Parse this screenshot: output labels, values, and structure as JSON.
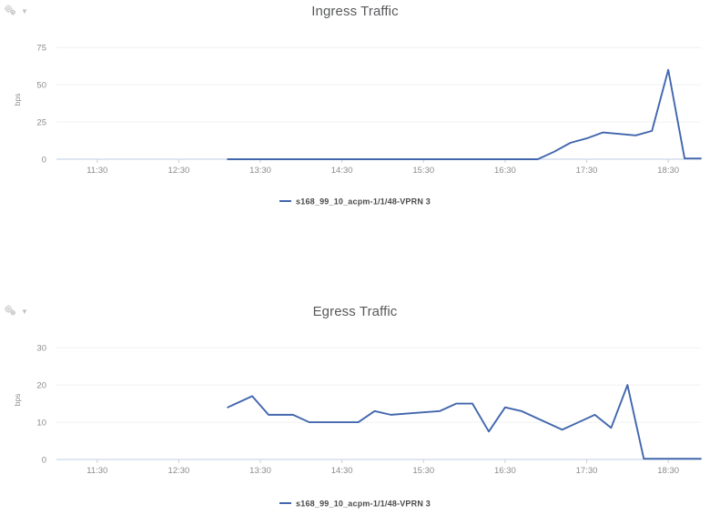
{
  "panels": [
    {
      "id": "ingress",
      "title": "Ingress Traffic",
      "gear_icon": "gear-icon",
      "caret_icon": "chevron-down-icon",
      "legend": {
        "label": "s168_99_10_acpm-1/1/48-VPRN 3",
        "color": "#4166ad"
      }
    },
    {
      "id": "egress",
      "title": "Egress Traffic",
      "gear_icon": "gear-icon",
      "caret_icon": "chevron-down-icon",
      "legend": {
        "label": "s168_99_10_acpm-1/1/48-VPRN 3",
        "color": "#4166ad"
      }
    }
  ],
  "chart_data": [
    {
      "type": "line",
      "title": "Ingress Traffic",
      "xlabel": "",
      "ylabel": "bps",
      "grid": true,
      "legend_position": "bottom",
      "xtick_labels": [
        "11:30",
        "12:30",
        "13:30",
        "14:30",
        "15:30",
        "16:30",
        "17:30",
        "18:30"
      ],
      "ytick_labels": [
        "0",
        "25",
        "50",
        "75"
      ],
      "ylim": [
        0,
        80
      ],
      "xlim": [
        "11:00",
        "18:54"
      ],
      "series": [
        {
          "name": "s168_99_10_acpm-1/1/48-VPRN 3",
          "color": "#4166ad",
          "x": [
            "13:06",
            "13:18",
            "13:30",
            "13:42",
            "13:54",
            "14:06",
            "14:18",
            "14:30",
            "14:42",
            "14:54",
            "15:06",
            "15:18",
            "15:30",
            "15:42",
            "15:54",
            "16:06",
            "16:18",
            "16:30",
            "16:42",
            "16:54",
            "17:06",
            "17:18",
            "17:30",
            "17:42",
            "17:54",
            "18:06",
            "18:18",
            "18:30",
            "18:42",
            "18:54"
          ],
          "values": [
            0,
            0,
            0,
            0,
            0,
            0,
            0,
            0,
            0,
            0,
            0,
            0,
            0,
            0,
            0,
            0,
            0,
            0,
            0,
            0,
            5,
            11,
            14,
            18,
            17,
            16,
            19,
            60,
            0.5,
            0.5
          ]
        }
      ]
    },
    {
      "type": "line",
      "title": "Egress Traffic",
      "xlabel": "",
      "ylabel": "bps",
      "grid": true,
      "legend_position": "bottom",
      "xtick_labels": [
        "11:30",
        "12:30",
        "13:30",
        "14:30",
        "15:30",
        "16:30",
        "17:30",
        "18:30"
      ],
      "ytick_labels": [
        "0",
        "10",
        "20",
        "30"
      ],
      "ylim": [
        0,
        32
      ],
      "xlim": [
        "11:00",
        "18:54"
      ],
      "series": [
        {
          "name": "s168_99_10_acpm-1/1/48-VPRN 3",
          "color": "#4166ad",
          "x": [
            "13:06",
            "13:24",
            "13:36",
            "13:54",
            "14:06",
            "14:24",
            "14:42",
            "14:54",
            "15:06",
            "15:24",
            "15:42",
            "15:54",
            "16:06",
            "16:18",
            "16:30",
            "16:42",
            "16:54",
            "17:12",
            "17:24",
            "17:36",
            "17:48",
            "18:00",
            "18:12",
            "18:30",
            "18:42",
            "18:54"
          ],
          "values": [
            14,
            17,
            12,
            12,
            10,
            10,
            10,
            13,
            12,
            12.5,
            13,
            15,
            15,
            7.5,
            14,
            13,
            11,
            8,
            10,
            12,
            8.5,
            20,
            0.2,
            0.2,
            0.2,
            0.2
          ]
        }
      ]
    }
  ]
}
